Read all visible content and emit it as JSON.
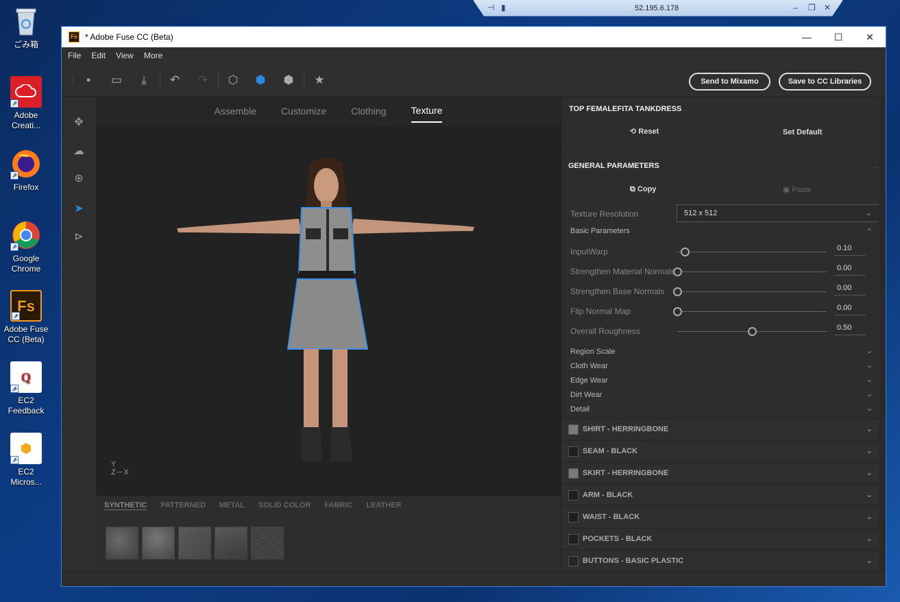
{
  "desktop": {
    "icons": [
      {
        "label": "ごみ箱",
        "icon": "recycle-bin-icon"
      },
      {
        "label": "Adobe Creati...",
        "icon": "adobe-cc-icon"
      },
      {
        "label": "Firefox",
        "icon": "firefox-icon"
      },
      {
        "label": "Google Chrome",
        "icon": "chrome-icon"
      },
      {
        "label": "Adobe Fuse CC (Beta)",
        "icon": "fuse-icon"
      },
      {
        "label": "EC2 Feedback",
        "icon": "ec2-feedback-icon"
      },
      {
        "label": "EC2 Micros...",
        "icon": "ec2-micro-icon"
      }
    ]
  },
  "rdp": {
    "address": "52.195.6.178"
  },
  "window": {
    "title": "* Adobe Fuse CC (Beta)",
    "app_icon_text": "Fs",
    "menu": [
      "File",
      "Edit",
      "View",
      "More"
    ]
  },
  "toolbar": {
    "send_mixamo": "Send to Mixamo",
    "save_cc": "Save to CC Libraries"
  },
  "tabs": [
    {
      "label": "Assemble",
      "active": false
    },
    {
      "label": "Customize",
      "active": false
    },
    {
      "label": "Clothing",
      "active": false
    },
    {
      "label": "Texture",
      "active": true
    }
  ],
  "axes": {
    "y": "Y",
    "x": "X",
    "z": "Z"
  },
  "material_tabs": [
    {
      "label": "SYNTHETIC",
      "active": true
    },
    {
      "label": "PATTERNED",
      "active": false
    },
    {
      "label": "METAL",
      "active": false
    },
    {
      "label": "SOLID COLOR",
      "active": false
    },
    {
      "label": "FABRIC",
      "active": false
    },
    {
      "label": "LEATHER",
      "active": false
    }
  ],
  "panel": {
    "title": "TOP FEMALEFITA TANKDRESS",
    "reset": "Reset",
    "set_default": "Set Default",
    "general_header": "GENERAL PARAMETERS",
    "copy": "Copy",
    "paste": "Paste",
    "texture_resolution_label": "Texture Resolution",
    "texture_resolution_value": "512 x 512",
    "basic_parameters": "Basic Parameters",
    "sliders": [
      {
        "label": "InputWarp",
        "value": "0.10",
        "fraction": 0.05
      },
      {
        "label": "Strengthen Material Normals",
        "value": "0.00",
        "fraction": 0.0
      },
      {
        "label": "Strengthen Base Normals",
        "value": "0.00",
        "fraction": 0.0
      },
      {
        "label": "Flip Normal Map",
        "value": "0.00",
        "fraction": 0.0
      },
      {
        "label": "Overall Roughness",
        "value": "0.50",
        "fraction": 0.5
      }
    ],
    "sections": [
      "Region Scale",
      "Cloth Wear",
      "Edge Wear",
      "Dirt Wear",
      "Detail"
    ],
    "materials": [
      {
        "label": "SHIRT - HERRINGBONE",
        "color": "#7a7a7a"
      },
      {
        "label": "SEAM - BLACK",
        "color": "#1e1e1e"
      },
      {
        "label": "SKIRT - HERRINGBONE",
        "color": "#7a7a7a"
      },
      {
        "label": "ARM - BLACK",
        "color": "#1e1e1e"
      },
      {
        "label": "WAIST - BLACK",
        "color": "#1e1e1e"
      },
      {
        "label": "POCKETS - BLACK",
        "color": "#1e1e1e"
      },
      {
        "label": "BUTTONS - BASIC PLASTIC",
        "color": "#262626"
      }
    ]
  }
}
